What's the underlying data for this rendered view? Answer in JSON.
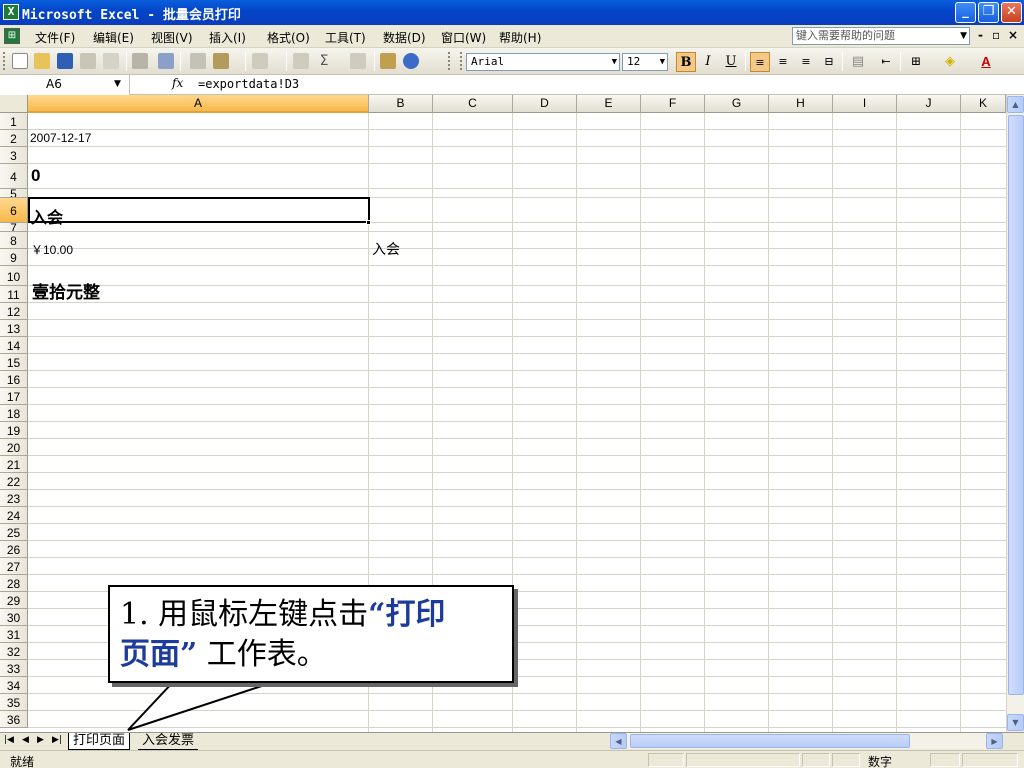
{
  "window": {
    "title": "Microsoft Excel - 批量会员打印",
    "icon": "excel-icon",
    "controls": {
      "minimize": "minimize-icon",
      "restore": "restore-icon",
      "close": "close-icon"
    }
  },
  "menu": {
    "items": [
      "文件(F)",
      "编辑(E)",
      "视图(V)",
      "插入(I)",
      "格式(O)",
      "工具(T)",
      "数据(D)",
      "窗口(W)",
      "帮助(H)"
    ],
    "help_placeholder": "键入需要帮助的问题",
    "doc_controls": {
      "minimize": "-",
      "restore": "▫",
      "close": "×"
    }
  },
  "format_bar": {
    "font": "Arial",
    "size": "12",
    "bold_label": "B",
    "italic_label": "I",
    "underline_label": "U",
    "bold_active": true,
    "align_left_active": true
  },
  "formula_bar": {
    "name_box": "A6",
    "fx_label": "fx",
    "formula": "=exportdata!D3"
  },
  "columns": [
    "A",
    "B",
    "C",
    "D",
    "E",
    "F",
    "G",
    "H",
    "I",
    "J",
    "K"
  ],
  "selected_column": "A",
  "rows": [
    "1",
    "2",
    "3",
    "4",
    "5",
    "6",
    "7",
    "8",
    "9",
    "10",
    "11",
    "12",
    "13",
    "14",
    "15",
    "16",
    "17",
    "18",
    "19",
    "20",
    "21",
    "22",
    "23",
    "24",
    "25",
    "26",
    "27",
    "28",
    "29",
    "30",
    "31",
    "32",
    "33",
    "34",
    "35",
    "36"
  ],
  "selected_row": "6",
  "cells": {
    "a2": "2007-12-17",
    "a4": "0",
    "a6": "入会",
    "a8": "￥10.00",
    "b8": "入会",
    "a10": "壹拾元整"
  },
  "callout": {
    "prefix": "1. 用鼠标左键点击",
    "open_quote": "“",
    "highlight_1": "打印",
    "highlight_2": "页面",
    "close_quote": "”",
    "suffix": "  工作表。"
  },
  "sheets": {
    "tabs": [
      "打印页面",
      "入会发票"
    ],
    "active": "打印页面"
  },
  "status": {
    "left": "就绪",
    "mode": "数字"
  }
}
